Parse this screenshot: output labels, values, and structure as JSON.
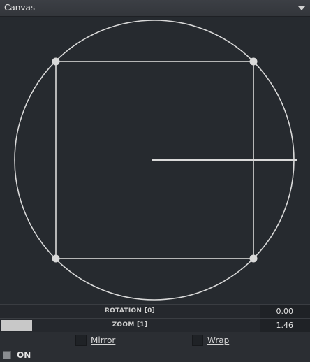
{
  "header": {
    "title": "Canvas",
    "dropdown_icon": "chevron-down-icon"
  },
  "params": [
    {
      "label": "ROTATION [0]",
      "value": "0.00",
      "slider_fraction": 0.0
    },
    {
      "label": "ZOOM [1]",
      "value": "1.46",
      "slider_fraction": 0.12
    }
  ],
  "options": {
    "mirror_label": "Mirror",
    "wrap_label": "Wrap",
    "mirror_checked": false,
    "wrap_checked": false
  },
  "enable": {
    "label": "ON",
    "checked": false
  },
  "colors": {
    "stroke": "#d9d9d9",
    "background": "#262a2f",
    "slider_fill": "#c8c8c8"
  }
}
